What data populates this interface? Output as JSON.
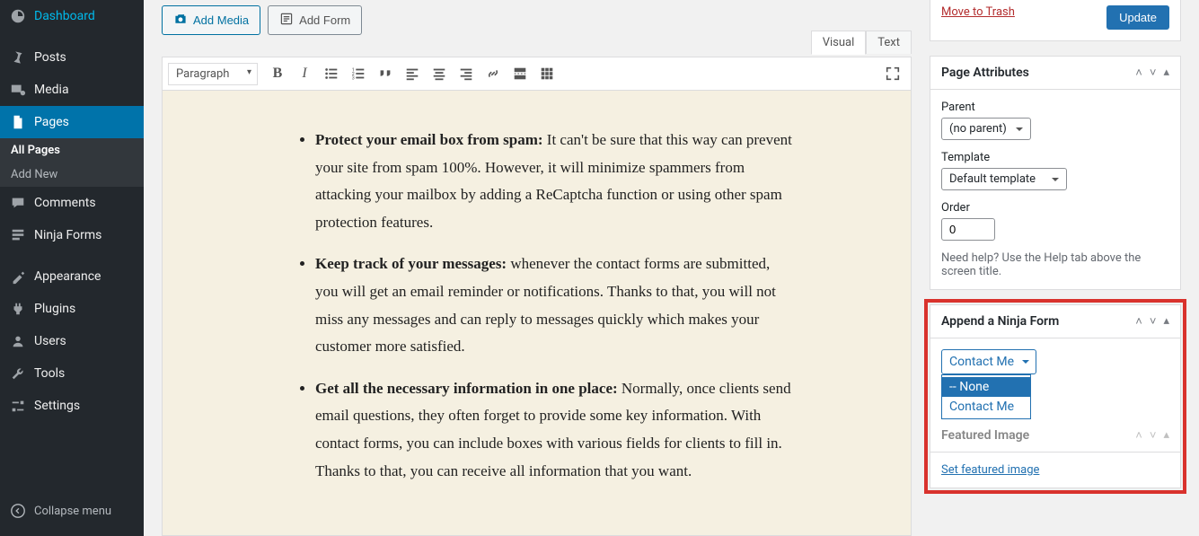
{
  "sidebar": {
    "items": [
      {
        "label": "Dashboard",
        "icon": "dashboard"
      },
      {
        "label": "Posts",
        "icon": "pin"
      },
      {
        "label": "Media",
        "icon": "media"
      },
      {
        "label": "Pages",
        "icon": "pages",
        "active": true
      },
      {
        "label": "Comments",
        "icon": "comment"
      },
      {
        "label": "Ninja Forms",
        "icon": "forms"
      },
      {
        "label": "Appearance",
        "icon": "appearance"
      },
      {
        "label": "Plugins",
        "icon": "plugin"
      },
      {
        "label": "Users",
        "icon": "users"
      },
      {
        "label": "Tools",
        "icon": "tools"
      },
      {
        "label": "Settings",
        "icon": "settings"
      }
    ],
    "sub_items": [
      {
        "label": "All Pages",
        "current": true
      },
      {
        "label": "Add New"
      }
    ],
    "collapse": "Collapse menu"
  },
  "toolbar": {
    "add_media": "Add Media",
    "add_form": "Add Form"
  },
  "editor": {
    "tabs": {
      "visual": "Visual",
      "text": "Text"
    },
    "format": "Paragraph",
    "bullets": [
      {
        "strong": "Protect your email box from spam:",
        "text": " It can't be sure that this way can prevent your site from spam 100%. However, it will minimize spammers from attacking your mailbox by adding a ReCaptcha function or using other spam protection features."
      },
      {
        "strong": "Keep track of your messages:",
        "text": " whenever the contact forms are submitted, you will get an email reminder or notifications. Thanks to that, you will not miss any messages and can reply to messages quickly which makes your customer more satisfied."
      },
      {
        "strong": "Get all the necessary information in one place:",
        "text": " Normally, once clients send email questions, they often forget to provide some key information. With contact forms, you can include boxes with various fields for clients to fill in. Thanks to that, you can receive all information that you want."
      }
    ]
  },
  "publish": {
    "trash": "Move to Trash",
    "update": "Update"
  },
  "page_attributes": {
    "title": "Page Attributes",
    "parent_label": "Parent",
    "parent_value": "(no parent)",
    "template_label": "Template",
    "template_value": "Default template",
    "order_label": "Order",
    "order_value": "0",
    "help": "Need help? Use the Help tab above the screen title."
  },
  "ninja_form": {
    "title": "Append a Ninja Form",
    "selected": "Contact Me",
    "options": [
      "-- None",
      "Contact Me"
    ]
  },
  "featured": {
    "title": "Featured Image",
    "set_link": "Set featured image"
  }
}
